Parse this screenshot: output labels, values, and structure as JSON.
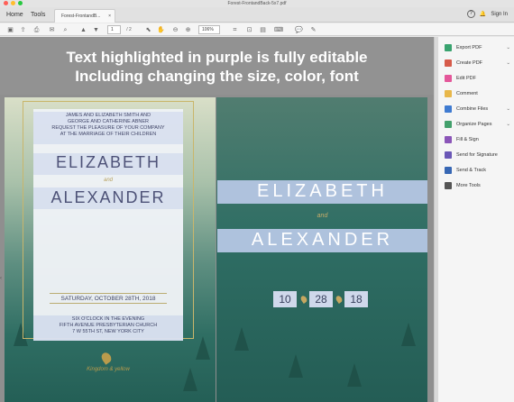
{
  "window": {
    "title": "Forest-FrontandBack-5x7.pdf"
  },
  "tabs": {
    "home": "Home",
    "tools": "Tools",
    "document": "Forest-FrontandB...",
    "close": "×"
  },
  "account": {
    "help": "?",
    "bell": "🔔",
    "signin": "Sign In"
  },
  "toolbar": {
    "page": "1",
    "page_total": "/ 2",
    "zoom": "106%"
  },
  "document": {
    "headline1": "Text highlighted in purple is fully editable",
    "headline2": "Including changing the size, color, font",
    "front": {
      "invite1": "JAMES AND ELIZABETH SMITH AND",
      "invite2": "GEORGE AND CATHERINE ABNER",
      "invite3": "REQUEST THE PLEASURE OF YOUR COMPANY",
      "invite4": "AT THE MARRIAGE OF THEIR CHILDREN",
      "name1": "ELIZABETH",
      "and": "and",
      "name2": "ALEXANDER",
      "date": "SATURDAY, OCTOBER 28TH, 2018",
      "time": "SIX O'CLOCK IN THE EVENING",
      "venue": "FIFTH AVENUE PRESBYTERIAN CHURCH",
      "address": "7 W 55TH ST, NEW YORK CITY",
      "signature": "Kingdom & yellow"
    },
    "back": {
      "name1": "ELIZABETH",
      "and": "and",
      "name2": "ALEXANDER",
      "month": "10",
      "day": "28",
      "year": "18"
    }
  },
  "sidebar": {
    "items": [
      {
        "label": "Export PDF",
        "color": "#39a36f",
        "has_chevron": true
      },
      {
        "label": "Create PDF",
        "color": "#d65b4a",
        "has_chevron": true
      },
      {
        "label": "Edit PDF",
        "color": "#e4579a",
        "has_chevron": false
      },
      {
        "label": "Comment",
        "color": "#e8b74a",
        "has_chevron": false
      },
      {
        "label": "Combine Files",
        "color": "#3f7bd1",
        "has_chevron": true
      },
      {
        "label": "Organize Pages",
        "color": "#43a06c",
        "has_chevron": true
      },
      {
        "label": "Fill & Sign",
        "color": "#8b55b8",
        "has_chevron": false
      },
      {
        "label": "Send for Signature",
        "color": "#6a57b6",
        "has_chevron": false
      },
      {
        "label": "Send & Track",
        "color": "#3767b4",
        "has_chevron": false
      },
      {
        "label": "More Tools",
        "color": "#555555",
        "has_chevron": false
      }
    ]
  }
}
